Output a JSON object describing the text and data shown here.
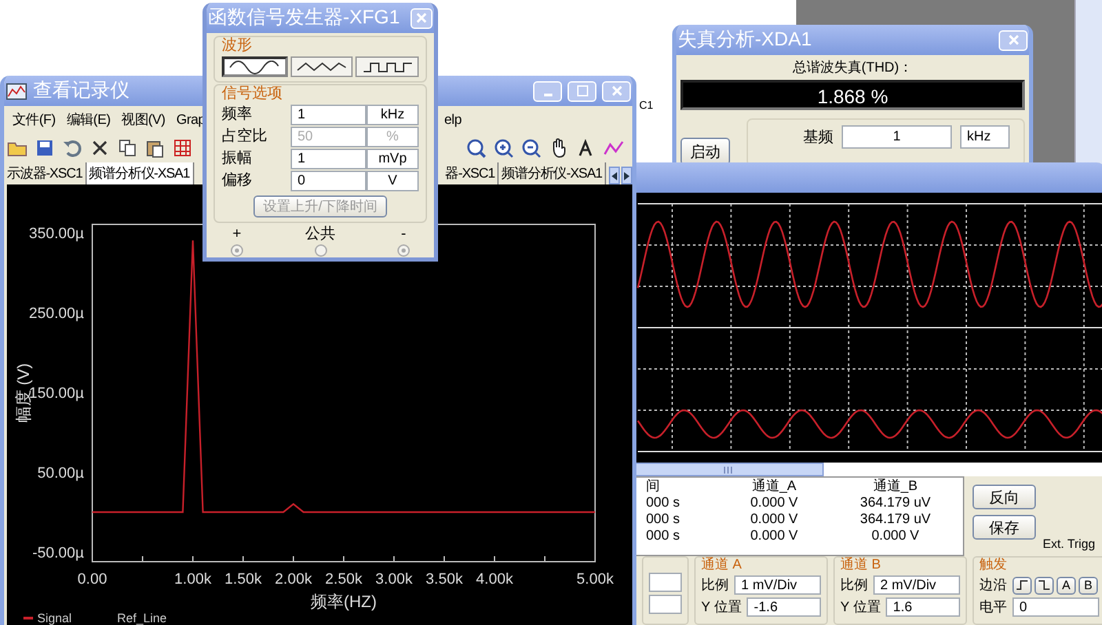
{
  "desktop": {
    "label": "C1"
  },
  "grapher_window": {
    "title": "查看记录仪",
    "menu": [
      "文件(F)",
      "编辑(E)",
      "视图(V)",
      "Grap",
      "elp"
    ],
    "tabs": [
      {
        "label": "示波器-XSC1",
        "selected": false
      },
      {
        "label": "频谱分析仪-XSA1",
        "selected": true
      }
    ],
    "tabs_right": [
      {
        "label": "器-XSC1",
        "selected": false
      },
      {
        "label": "频谱分析仪-XSA1",
        "selected": false
      }
    ],
    "chart_data": {
      "type": "line",
      "xlabel": "频率(HZ)",
      "ylabel": "幅度 (V)",
      "x": [
        0,
        500,
        900,
        1000,
        1100,
        1500,
        1900,
        2000,
        2100,
        2500,
        3000,
        3500,
        4000,
        4500,
        5000
      ],
      "series": [
        {
          "name": "Signal",
          "color": "#c8202a",
          "values": [
            0,
            0,
            0,
            340,
            0,
            0,
            0,
            10,
            0,
            0,
            0,
            0,
            0,
            0,
            0
          ]
        }
      ],
      "xlim": [
        0,
        5000
      ],
      "ylim": [
        -62,
        360
      ],
      "xticks": [
        {
          "value": 0,
          "label": "0.00"
        },
        {
          "value": 1000,
          "label": "1.00k"
        },
        {
          "value": 1500,
          "label": "1.50k"
        },
        {
          "value": 2000,
          "label": "2.00k"
        },
        {
          "value": 2500,
          "label": "2.50k"
        },
        {
          "value": 3000,
          "label": "3.00k"
        },
        {
          "value": 3500,
          "label": "3.50k"
        },
        {
          "value": 4000,
          "label": "4.00k"
        },
        {
          "value": 5000,
          "label": "5.00k"
        }
      ],
      "yticks": [
        {
          "value": 350,
          "label": "350.00µ"
        },
        {
          "value": 250,
          "label": "250.00µ"
        },
        {
          "value": 150,
          "label": "150.00µ"
        },
        {
          "value": 50,
          "label": "50.00µ"
        },
        {
          "value": -50,
          "label": "-50.00µ"
        }
      ]
    },
    "ref_legend": "Ref_Line"
  },
  "function_generator": {
    "title": "函数信号发生器-XFG1",
    "waveform_group": "波形",
    "waveforms": [
      {
        "kind": "sine",
        "selected": true
      },
      {
        "kind": "triangle",
        "selected": false
      },
      {
        "kind": "square",
        "selected": false
      }
    ],
    "options_group": "信号选项",
    "fields": [
      {
        "label": "频率",
        "value": "1",
        "unit": "kHz",
        "disabled": false
      },
      {
        "label": "占空比",
        "value": "50",
        "unit": "%",
        "disabled": true
      },
      {
        "label": "振幅",
        "value": "1",
        "unit": "mVp",
        "disabled": false
      },
      {
        "label": "偏移",
        "value": "0",
        "unit": "V",
        "disabled": false
      }
    ],
    "rise_fall_button": {
      "label": "设置上升/下降时间",
      "disabled": true
    },
    "terminals": [
      "+",
      "公共",
      "-"
    ]
  },
  "distortion_analyzer": {
    "title": "失真分析-XDA1",
    "thd_label": "总谐波失真(THD)：",
    "thd_value": "1.868 %",
    "start_button": "启动",
    "fundamental_label": "基频",
    "fundamental_value": "1",
    "fundamental_unit": "kHz"
  },
  "oscilloscope": {
    "readout": {
      "columns": [
        "间",
        "通道_A",
        "通道_B"
      ],
      "rows": [
        [
          "000 s",
          "0.000 V",
          "364.179 uV"
        ],
        [
          "000 s",
          "0.000 V",
          "364.179 uV"
        ],
        [
          "000 s",
          "0.000 V",
          "0.000 V"
        ]
      ]
    },
    "buttons": [
      "反向",
      "保存"
    ],
    "ext_trigger": "Ext. Trigg",
    "channels": [
      {
        "title": "通道 A",
        "scale_label": "比例",
        "scale": "1 mV/Div",
        "ypos_label": "Y 位置",
        "ypos": "-1.6"
      },
      {
        "title": "通道 B",
        "scale_label": "比例",
        "scale": "2 mV/Div",
        "ypos_label": "Y 位置",
        "ypos": "1.6"
      }
    ],
    "trigger": {
      "title": "触发",
      "edge_label": "边沿",
      "trigger_level_label": "电平",
      "trigger_level": "0",
      "sources": [
        "A",
        "B"
      ]
    }
  }
}
